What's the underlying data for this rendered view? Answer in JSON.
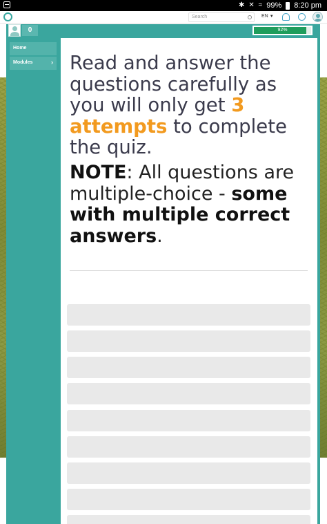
{
  "status_bar": {
    "battery": "99%",
    "time": "8:20 pm",
    "icons": [
      "menu-icon",
      "bluetooth-icon",
      "mute-icon",
      "wifi-icon",
      "battery-icon"
    ]
  },
  "navbar": {
    "search_placeholder": "Search",
    "language": "EN",
    "icons": [
      "logo-icon",
      "search-icon",
      "bell-icon",
      "globe-icon",
      "avatar-icon"
    ]
  },
  "user": {
    "points": "0",
    "progress_label": "92%",
    "progress_value": 92
  },
  "sidebar": {
    "items": [
      {
        "label": "Home"
      },
      {
        "label": "Modules"
      }
    ]
  },
  "quiz": {
    "intro_1": "Read and answer the questions carefully as you will only get ",
    "intro_highlight": "3 attempts",
    "intro_2": " to complete the quiz.",
    "note_label": "NOTE",
    "note_text": ": All questions are multiple-choice - ",
    "note_bold": "some with multiple correct answers",
    "note_end": ".",
    "option_count_visible": 9
  },
  "colors": {
    "teal": "#3aa69e",
    "accent": "#f29a1f",
    "progress_green": "#1f9d5c",
    "option_bg": "#e9e9e9"
  }
}
